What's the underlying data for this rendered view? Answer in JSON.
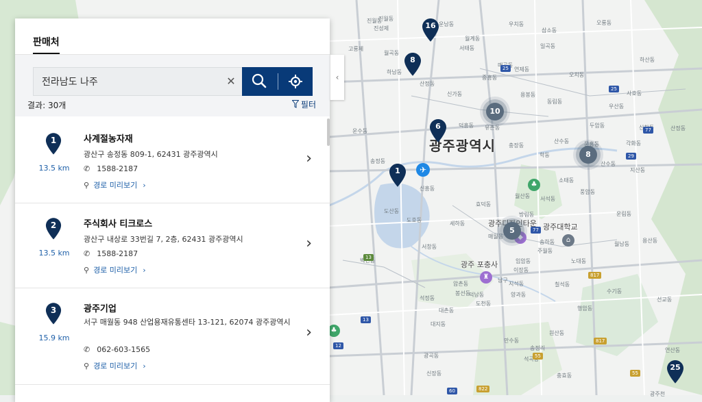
{
  "panel": {
    "tab_label": "판매처",
    "search": {
      "value": "전라남도 나주",
      "placeholder": ""
    },
    "results_text": "결과: 30개",
    "filter_label": "필터",
    "items": [
      {
        "number": "1",
        "distance": "13.5 km",
        "name": "사계절농자재",
        "address": "광산구 송정동 809-1, 62431 광주광역시",
        "phone": "1588-2187",
        "route": "경로 미리보기"
      },
      {
        "number": "2",
        "distance": "13.5 km",
        "name": "주식회사 티크로스",
        "address": "광산구 내상로 33번길 7, 2층, 62431 광주광역시",
        "phone": "1588-2187",
        "route": "경로 미리보기"
      },
      {
        "number": "3",
        "distance": "15.9 km",
        "name": "광주기업",
        "address": "서구 매월동 948 산업용재유통센타 13-121, 62074 광주광역시",
        "phone": "062-603-1565",
        "route": "경로 미리보기"
      }
    ]
  },
  "map": {
    "city_label": "광주광역시",
    "pois": [
      "광주 포충사",
      "광주대학교",
      "광주디자인타운"
    ],
    "pins": [
      "16",
      "8",
      "6",
      "1",
      "25"
    ],
    "clusters": [
      "10",
      "8",
      "5"
    ],
    "labels": [
      "진월동",
      "진성제",
      "고룡제",
      "월곡동",
      "하남동",
      "산정동",
      "운수동",
      "신가동",
      "덕흥동",
      "유촌동",
      "신흥동",
      "송정동",
      "도산동",
      "도호동",
      "세하동",
      "서창동",
      "용두동",
      "매월동",
      "벽진동",
      "대지동",
      "석정동",
      "압촌동",
      "덕남동",
      "양과동",
      "도천동",
      "대촌동",
      "효덕동",
      "월산동",
      "주월동",
      "방림동",
      "송하동",
      "임암동",
      "이장동",
      "남구",
      "지석동",
      "봉선동",
      "칠석동",
      "원산동",
      "신장동",
      "광곡동",
      "송정리",
      "우산동",
      "두암동",
      "동림동",
      "풍암동",
      "각화동",
      "문흥동",
      "오치동",
      "용봉동",
      "연제동",
      "매곡동",
      "일곡동",
      "삼소동",
      "산수동",
      "학동",
      "소태동",
      "용산동",
      "운림동",
      "지산동",
      "산수동",
      "충장동",
      "서석동",
      "노대동",
      "월남동",
      "진월동",
      "행암동",
      "선교동",
      "수기동",
      "만수동",
      "석곡동",
      "충효동",
      "연산동",
      "광주천",
      "서태동",
      "중흥동",
      "월계동",
      "운남동",
      "우치동",
      "오룡동",
      "하산동",
      "사호동",
      "신창동",
      "산정동",
      "제1터널"
    ],
    "road_numbers": [
      "25",
      "25",
      "29",
      "77",
      "77",
      "817",
      "817",
      "55",
      "55",
      "13",
      "12",
      "822",
      "13",
      "60"
    ]
  }
}
